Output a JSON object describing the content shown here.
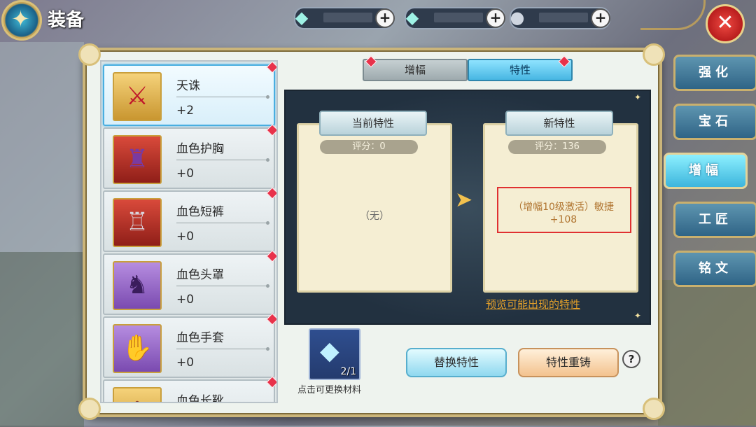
{
  "header": {
    "title": "装备"
  },
  "resources": [
    {
      "icon": "crystal-icon",
      "value": ""
    },
    {
      "icon": "crystal-lock-icon",
      "value": ""
    },
    {
      "icon": "coin-icon",
      "value": ""
    }
  ],
  "equipment": [
    {
      "name": "天诛",
      "level": "+2",
      "icon": "sword-icon"
    },
    {
      "name": "血色护胸",
      "level": "+0",
      "icon": "armor-icon"
    },
    {
      "name": "血色短裤",
      "level": "+0",
      "icon": "pants-icon"
    },
    {
      "name": "血色头罩",
      "level": "+0",
      "icon": "hood-icon"
    },
    {
      "name": "血色手套",
      "level": "+0",
      "icon": "glove-icon"
    },
    {
      "name": "血色长靴",
      "level": "",
      "icon": "boots-icon"
    }
  ],
  "tabs": {
    "amplify": "增幅",
    "traits": "特性"
  },
  "current": {
    "title": "当前特性",
    "score": "评分：0",
    "content": "（无）"
  },
  "new": {
    "title": "新特性",
    "score": "评分：136",
    "content": "（增幅10级激活）敏捷 +108"
  },
  "preview_link": "预览可能出现的特性",
  "material": {
    "count": "2/1",
    "label": "点击可更换材料"
  },
  "buttons": {
    "replace": "替换特性",
    "reforge": "特性重铸",
    "help": "?"
  },
  "side_menu": [
    "强化",
    "宝石",
    "增幅",
    "工匠",
    "铭文"
  ],
  "colors": {
    "accent": "#47b6e3",
    "alert": "#e8324a",
    "gold": "#c9b06e"
  }
}
